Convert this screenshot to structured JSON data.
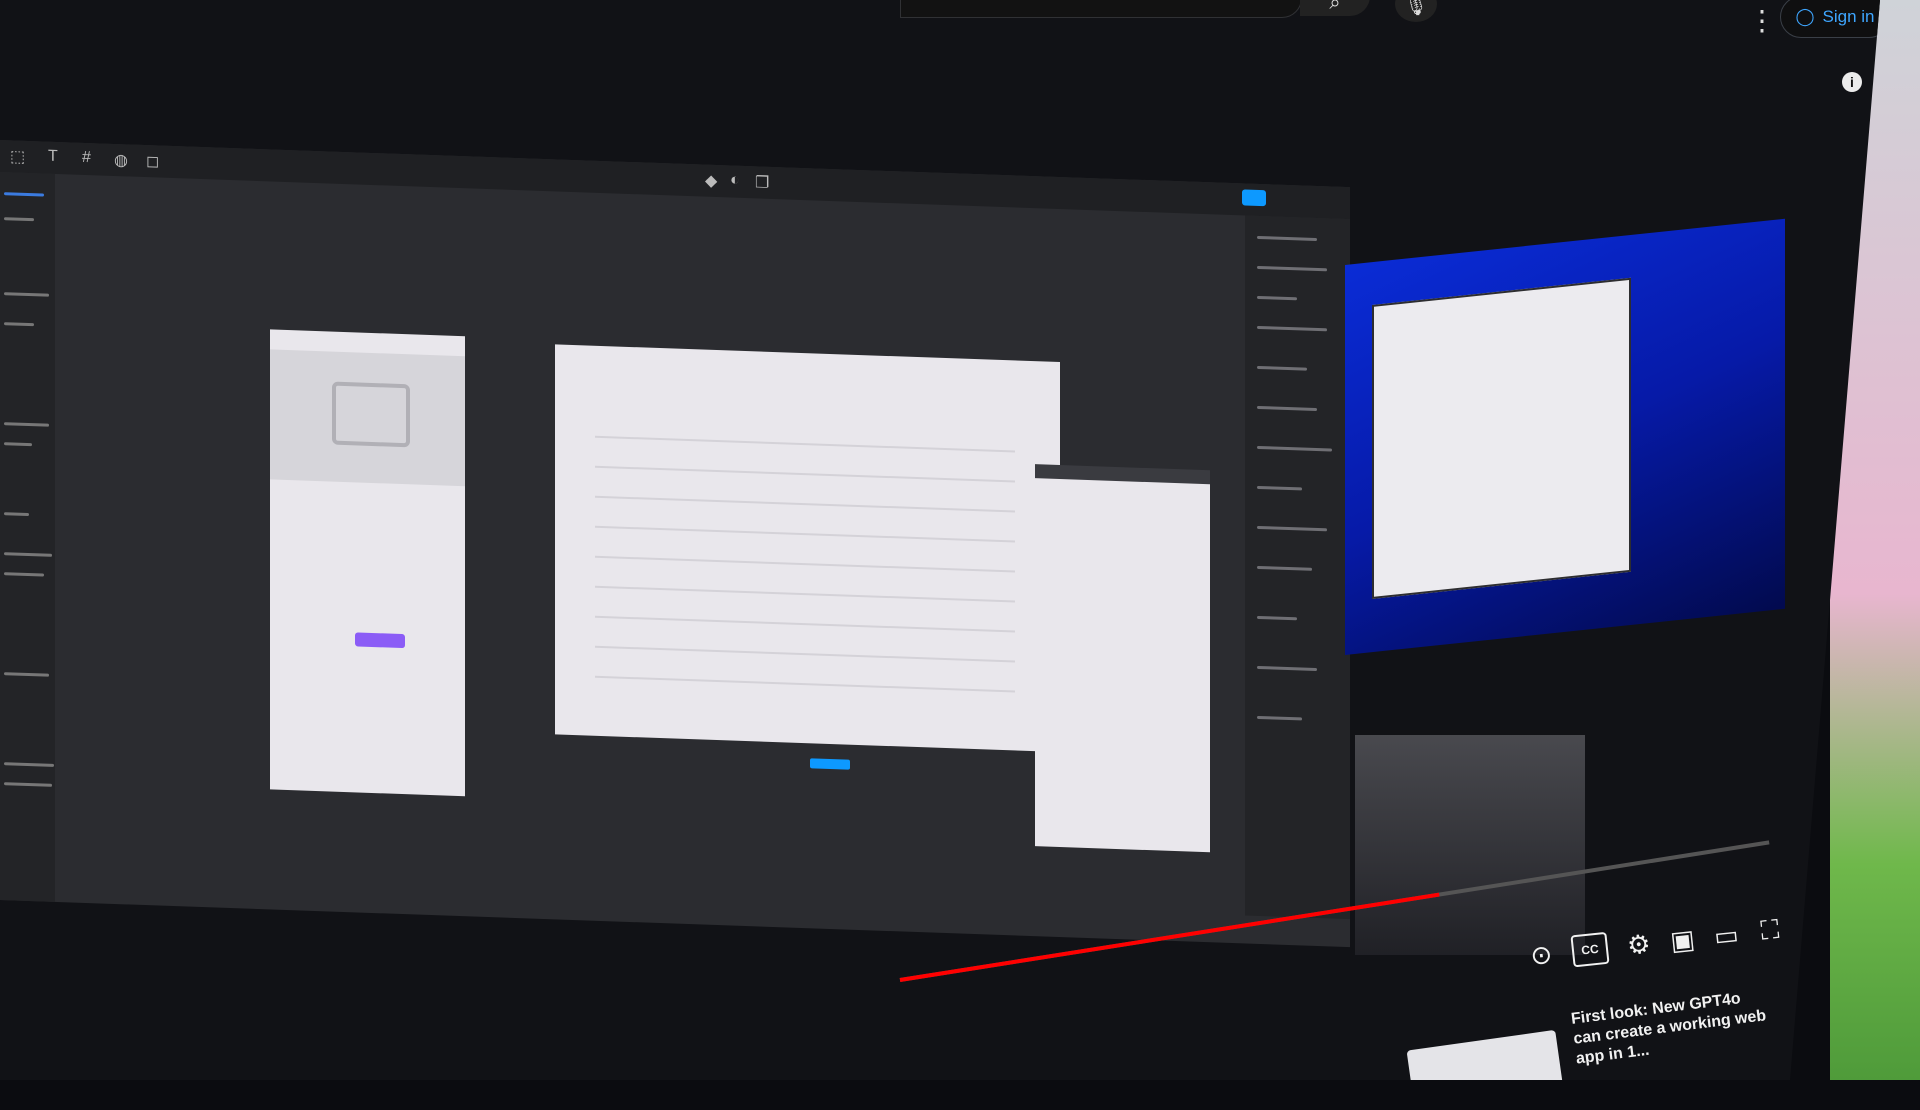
{
  "header": {
    "sign_in_label": "Sign in",
    "more_icon": "vertical-ellipsis-icon",
    "search_icon": "search-icon",
    "mic_icon": "mic-icon"
  },
  "player": {
    "progress_fraction": 0.62,
    "accent_color": "#ff0000",
    "cc_label": "CC"
  },
  "up_next": {
    "title": "First look: New GPT4o can create a working web app in 1..."
  }
}
